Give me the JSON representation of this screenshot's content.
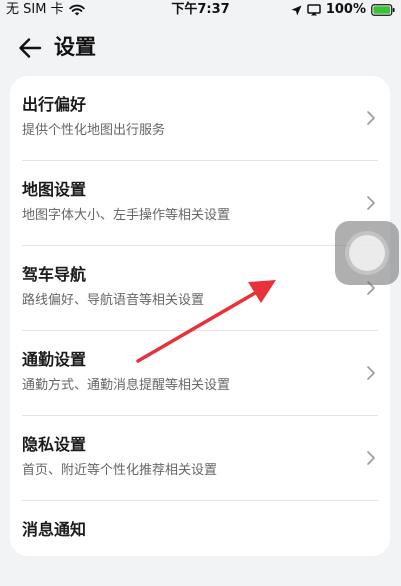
{
  "status_bar": {
    "carrier": "无 SIM 卡",
    "time": "下午7:37",
    "battery": "100%"
  },
  "header": {
    "title": "设置"
  },
  "settings": [
    {
      "title": "出行偏好",
      "desc": "提供个性化地图出行服务"
    },
    {
      "title": "地图设置",
      "desc": "地图字体大小、左手操作等相关设置"
    },
    {
      "title": "驾车导航",
      "desc": "路线偏好、导航语音等相关设置"
    },
    {
      "title": "通勤设置",
      "desc": "通勤方式、通勤消息提醒等相关设置"
    },
    {
      "title": "隐私设置",
      "desc": "首页、附近等个性化推荐相关设置"
    },
    {
      "title": "消息通知",
      "desc": ""
    }
  ],
  "icons": {
    "back": "back-arrow-icon",
    "chevron": "chevron-right-icon",
    "wifi": "wifi-icon",
    "location": "location-icon",
    "screen_mirror": "screen-mirror-icon",
    "battery": "battery-icon"
  },
  "colors": {
    "background": "#f2f3f5",
    "card": "#ffffff",
    "battery_fill": "#3cc13b",
    "annotation": "#e8313a"
  }
}
